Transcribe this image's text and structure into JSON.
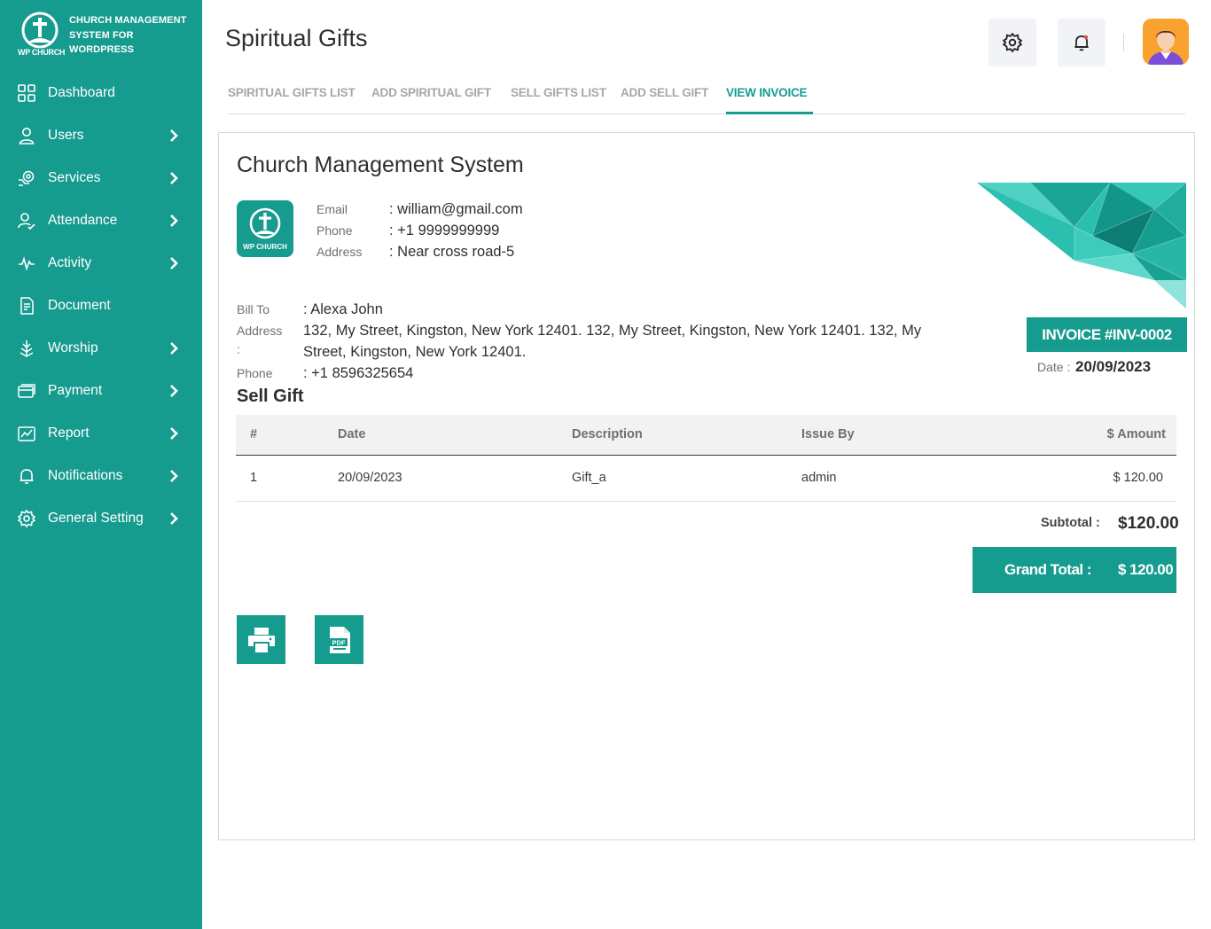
{
  "sidebar": {
    "brand_line1": "CHURCH MANAGEMENT",
    "brand_line2": "SYSTEM FOR",
    "brand_line3": "WORDPRESS",
    "logo_text": "WP CHURCH",
    "items": [
      {
        "label": "Dashboard",
        "icon": "grid-icon",
        "has_submenu": false
      },
      {
        "label": "Users",
        "icon": "user-icon",
        "has_submenu": true
      },
      {
        "label": "Services",
        "icon": "services-icon",
        "has_submenu": true
      },
      {
        "label": "Attendance",
        "icon": "attendance-icon",
        "has_submenu": true
      },
      {
        "label": "Activity",
        "icon": "pulse-icon",
        "has_submenu": true
      },
      {
        "label": "Document",
        "icon": "document-icon",
        "has_submenu": false
      },
      {
        "label": "Worship",
        "icon": "worship-icon",
        "has_submenu": true
      },
      {
        "label": "Payment",
        "icon": "payment-icon",
        "has_submenu": true
      },
      {
        "label": "Report",
        "icon": "report-icon",
        "has_submenu": true
      },
      {
        "label": "Notifications",
        "icon": "bell-icon",
        "has_submenu": true
      },
      {
        "label": "General Setting",
        "icon": "gear-icon",
        "has_submenu": true
      }
    ]
  },
  "header": {
    "title": "Spiritual Gifts"
  },
  "tabs": [
    {
      "label": "SPIRITUAL GIFTS LIST",
      "active": false
    },
    {
      "label": "ADD SPIRITUAL GIFT",
      "active": false
    },
    {
      "label": "SELL GIFTS LIST",
      "active": false
    },
    {
      "label": "ADD SELL GIFT",
      "active": false
    },
    {
      "label": "VIEW INVOICE",
      "active": true
    }
  ],
  "invoice": {
    "company_name": "Church Management System",
    "logo_text": "WP CHURCH",
    "email_label": "Email",
    "email_value": ": william@gmail.com",
    "phone_label": "Phone",
    "phone_value": ": +1 9999999999",
    "address_label": "Address",
    "address_value": ": Near cross road-5",
    "bill_to_label": "Bill To",
    "bill_to_value": ": Alexa John",
    "bill_address_label": "Address",
    "bill_address_colon": ":",
    "bill_address_value": "132, My Street, Kingston, New York 12401. 132, My Street, Kingston, New York 12401. 132, My Street, Kingston, New York 12401.",
    "bill_phone_label": "Phone",
    "bill_phone_value": ": +1 8596325654",
    "number": "INVOICE #INV-0002",
    "date_label": "Date :",
    "date_value": "20/09/2023",
    "section_title": "Sell Gift",
    "table": {
      "headers": [
        "#",
        "Date",
        "Description",
        "Issue By",
        "$ Amount"
      ],
      "rows": [
        [
          "1",
          "20/09/2023",
          "Gift_a",
          "admin",
          "$ 120.00"
        ]
      ]
    },
    "subtotal_label": "Subtotal :",
    "subtotal_value": "$120.00",
    "grand_total_label": "Grand Total :",
    "grand_total_value": "$ 120.00"
  },
  "colors": {
    "accent": "#169b8f",
    "muted_text": "#707070",
    "tab_inactive": "#a7a7a7"
  }
}
